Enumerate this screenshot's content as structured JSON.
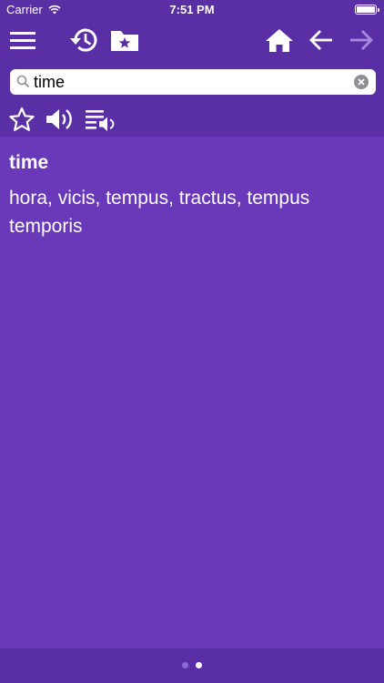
{
  "status_bar": {
    "carrier": "Carrier",
    "time": "7:51 PM"
  },
  "toolbar": {
    "icons": [
      "menu-icon",
      "history-icon",
      "favorites-folder-icon",
      "home-icon",
      "back-arrow-icon",
      "forward-arrow-icon"
    ]
  },
  "search": {
    "value": "time"
  },
  "actions": {
    "icons": [
      "star-icon",
      "speaker-icon",
      "playlist-audio-icon"
    ]
  },
  "entry": {
    "word": "time",
    "translation": "hora, vicis, tempus, tractus, tempus temporis"
  },
  "pager": {
    "page_count": 2,
    "current_page": 2
  },
  "colors": {
    "header": "#5a2fa6",
    "content": "#6939b9",
    "text": "#ffffff",
    "disabled_icon": "#a98ae0"
  }
}
